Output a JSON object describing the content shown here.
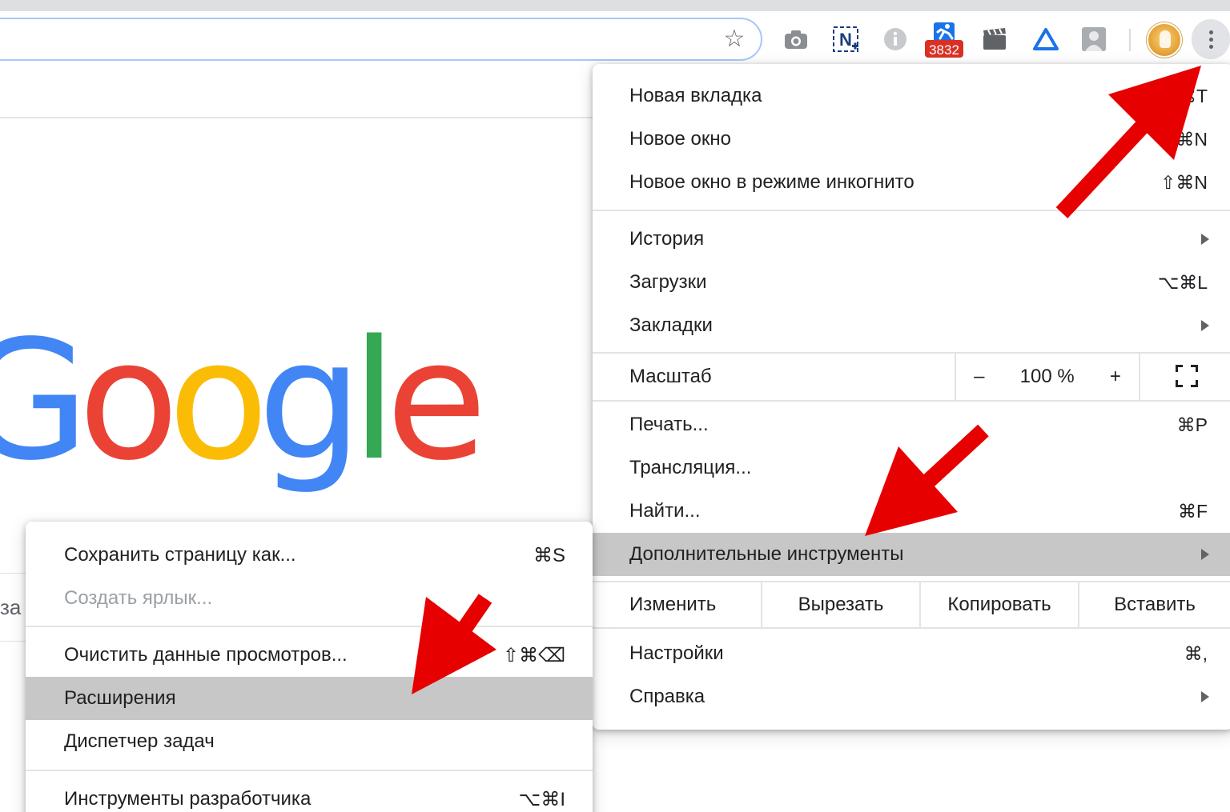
{
  "toolbar": {
    "badge_count": "3832"
  },
  "google_logo": {
    "letters": [
      {
        "char": "G",
        "color": "#4285F4"
      },
      {
        "char": "o",
        "color": "#EA4335"
      },
      {
        "char": "o",
        "color": "#FBBC05"
      },
      {
        "char": "g",
        "color": "#4285F4"
      },
      {
        "char": "l",
        "color": "#34A853"
      },
      {
        "char": "e",
        "color": "#EA4335"
      }
    ]
  },
  "search": {
    "partial_text": "за"
  },
  "main_menu": {
    "items": [
      {
        "label": "Новая вкладка",
        "shortcut": "⌘T"
      },
      {
        "label": "Новое окно",
        "shortcut": "⌘N"
      },
      {
        "label": "Новое окно в режиме инкогнито",
        "shortcut": "⇧⌘N"
      },
      {
        "label": "История",
        "shortcut": ""
      },
      {
        "label": "Загрузки",
        "shortcut": "⌥⌘L"
      },
      {
        "label": "Закладки",
        "shortcut": ""
      },
      {
        "label": "Печать...",
        "shortcut": "⌘P"
      },
      {
        "label": "Трансляция...",
        "shortcut": ""
      },
      {
        "label": "Найти...",
        "shortcut": "⌘F"
      },
      {
        "label": "Дополнительные инструменты",
        "shortcut": ""
      },
      {
        "label": "Настройки",
        "shortcut": "⌘,"
      },
      {
        "label": "Справка",
        "shortcut": ""
      }
    ],
    "zoom": {
      "label": "Масштаб",
      "minus": "–",
      "value": "100 %",
      "plus": "+"
    },
    "edit": {
      "label": "Изменить",
      "cut": "Вырезать",
      "copy": "Копировать",
      "paste": "Вставить"
    }
  },
  "sub_menu": {
    "items": [
      {
        "label": "Сохранить страницу как...",
        "shortcut": "⌘S"
      },
      {
        "label": "Создать ярлык...",
        "shortcut": ""
      },
      {
        "label": "Очистить данные просмотров...",
        "shortcut": "⇧⌘⌫"
      },
      {
        "label": "Расширения",
        "shortcut": ""
      },
      {
        "label": "Диспетчер задач",
        "shortcut": ""
      },
      {
        "label": "Инструменты разработчика",
        "shortcut": "⌥⌘I"
      }
    ]
  },
  "colors": {
    "highlight": "#c7c7c7",
    "arrow": "#e60000",
    "badge": "#d93025"
  }
}
